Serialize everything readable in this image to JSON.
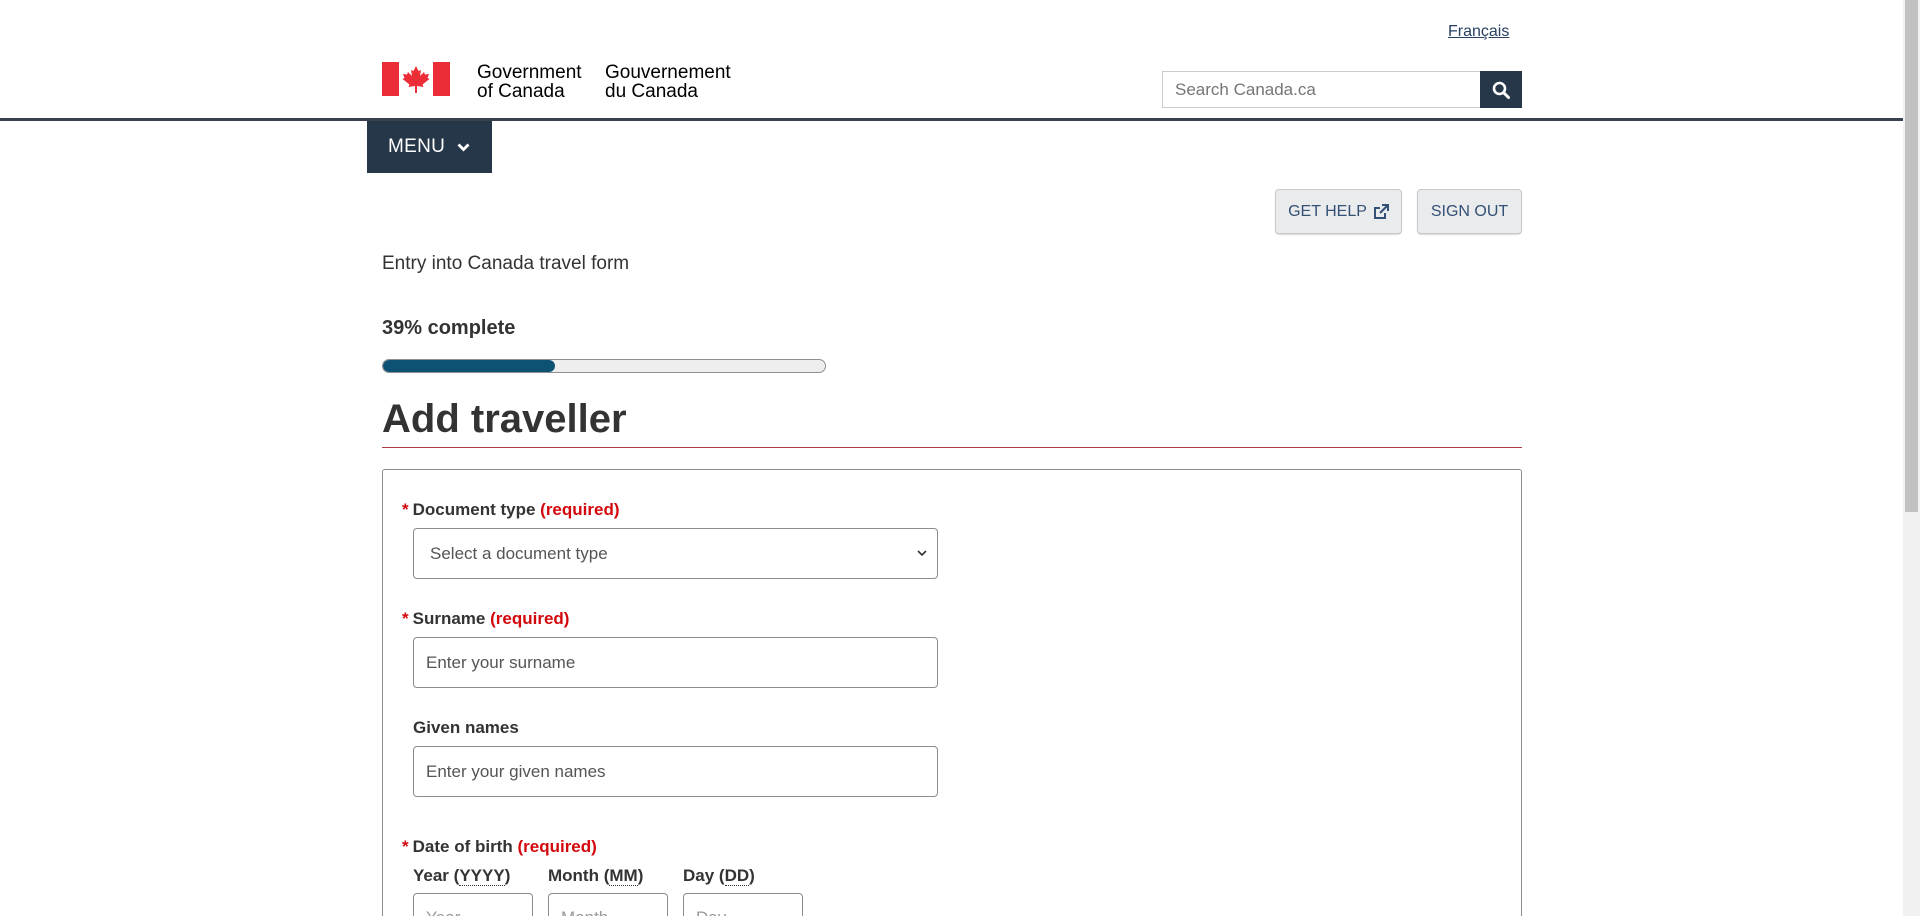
{
  "header": {
    "language_toggle": "Français",
    "signature_en_line1": "Government",
    "signature_en_line2": "of Canada",
    "signature_fr_line1": "Gouvernement",
    "signature_fr_line2": "du Canada",
    "search_placeholder": "Search Canada.ca",
    "menu_label": "MENU"
  },
  "actions": {
    "get_help": "GET HELP",
    "sign_out": "SIGN OUT"
  },
  "form": {
    "form_title": "Entry into Canada travel form",
    "progress_label": "39% complete",
    "progress_fraction": 0.39,
    "page_title": "Add traveller",
    "required_mark": "*",
    "required_text": "(required)",
    "document_type": {
      "label": "Document type",
      "selected": "Select a document type"
    },
    "surname": {
      "label": "Surname",
      "placeholder": "Enter your surname"
    },
    "given_names": {
      "label": "Given names",
      "placeholder": "Enter your given names"
    },
    "date_of_birth": {
      "label": "Date of birth",
      "year_label": "Year",
      "year_format": "YYYY",
      "year_placeholder": "Year",
      "month_label": "Month",
      "month_format": "MM",
      "month_placeholder": "Month",
      "day_label": "Day",
      "day_format": "DD",
      "day_placeholder": "Day"
    }
  },
  "colors": {
    "brand_dark": "#26374a",
    "progress_fill": "#0e5273",
    "required_red": "#d3080c",
    "title_rule": "#af3c43",
    "flag_red": "#eb2d37"
  }
}
